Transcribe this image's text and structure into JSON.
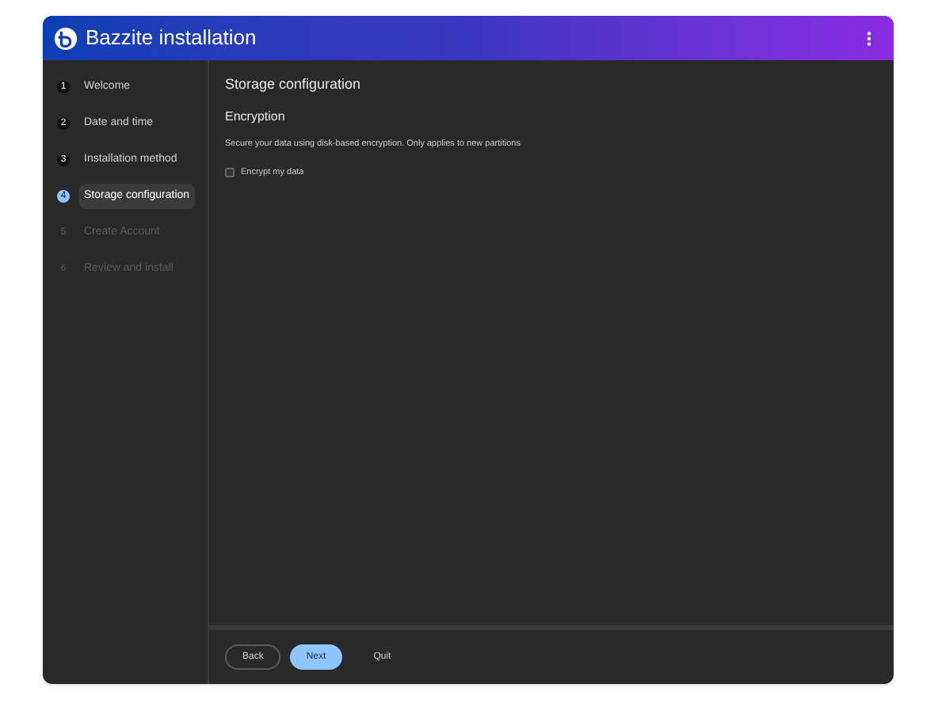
{
  "window": {
    "title": "Bazzite installation"
  },
  "steps": [
    {
      "number": "1",
      "label": "Welcome",
      "selected": false,
      "disabled": false
    },
    {
      "number": "2",
      "label": "Date and time",
      "selected": false,
      "disabled": false
    },
    {
      "number": "3",
      "label": "Installation method",
      "selected": false,
      "disabled": false
    },
    {
      "number": "4",
      "label": "Storage configuration",
      "selected": true,
      "disabled": false
    },
    {
      "number": "5",
      "label": "Create Account",
      "selected": false,
      "disabled": true
    },
    {
      "number": "6",
      "label": "Review and install",
      "selected": false,
      "disabled": true
    }
  ],
  "page": {
    "title": "Storage configuration",
    "section": "Encryption",
    "description": "Secure your data using disk-based encryption. Only applies to new partitions",
    "checkbox": {
      "label": "Encrypt my data",
      "checked": false
    }
  },
  "buttons": {
    "back": "Back",
    "next": "Next",
    "quit": "Quit"
  }
}
